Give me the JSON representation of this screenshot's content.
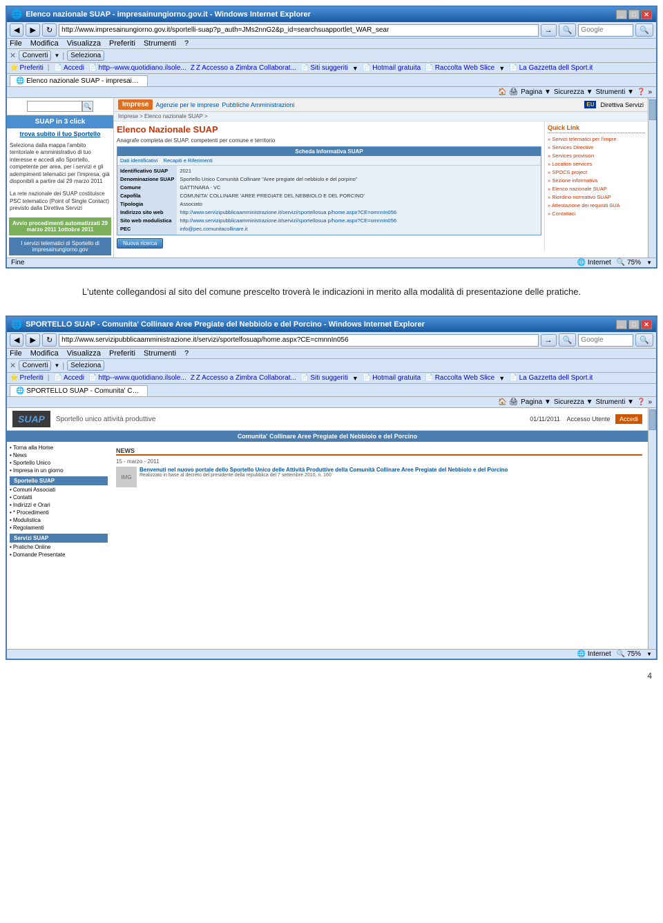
{
  "browser1": {
    "title": "Elenco nazionale SUAP - impresainungiorno.gov.it - Windows Internet Explorer",
    "url": "http://www.impresainungiorno.gov.it/sportelli-suap?p_auth=JMs2nnG2&p_id=searchsuapportlet_WAR_sear",
    "menu": {
      "file": "File",
      "modifica": "Modifica",
      "visualizza": "Visualizza",
      "preferiti": "Preferiti",
      "strumenti": "Strumenti",
      "help": "?"
    },
    "toolbar": {
      "converti": "Converti",
      "seleziona": "Seleziona"
    },
    "bookmarks": {
      "preferiti": "Preferiti",
      "accedi": "Accedi",
      "quotidiano": "http--www.quotidiano.ilsole...",
      "zimbra": "Z Accesso a Zimbra Collaborat...",
      "siti_suggeriti": "Siti suggeriti",
      "hotmail": "Hotmail gratuita",
      "raccolta": "Raccolta Web Slice",
      "gazzetta": "La Gazzetta dell Sport.it"
    },
    "tab": "Elenco nazionale SUAP - impresainungiorno.gov.it",
    "status": {
      "left": "Fine",
      "internet": "Internet",
      "zoom": "75%"
    },
    "page": {
      "search_placeholder": "",
      "left_panel": {
        "title": "SUAP in 3 click",
        "subtitle": "trova subito il tuo Sportello",
        "text1": "Seleziona dalla mappa l'ambito territoriale e amministrativo di tuo interesse e accedi allo Sportello, competente per area, per i servizi e gli adempimenti telematici per l'impresa, già disponibili a partire dal 29 marzo 2011",
        "text2": "La rete nazionale dei SUAP costituisce PSC telematico (Point of Single Contact) previsto dalla Direttiva Servizi",
        "green_box": "Avvio procedimenti automatizzati 29 marzo 2011 1ottobre 2011",
        "blue_box": "I servizi telematici di Sportello di impresainungiorno.gov"
      },
      "top_nav": {
        "imprese": "Imprese",
        "agenzie": "Agenzie per le imprese",
        "pa": "Pubbliche Amministrazioni",
        "eu": "EU",
        "direttiva": "Direttiva Servizi"
      },
      "breadcrumb": "Imprese > Elenco nazionale SUAP >",
      "main_heading": "Elenco Nazionale SUAP",
      "main_desc": "Anagrafe completa dei SUAP, competenti per comune e territorio",
      "info_card": {
        "title": "Scheda Informativa SUAP",
        "fields": {
          "id": "Identificativo SUAP",
          "denominazione": "Denominazione SUAP",
          "comune": "Comune",
          "capofila": "Capofila",
          "tipologia": "Tipologia",
          "indirizzo": "Indirizzo sito web",
          "sito_web": "Sito web modulistica",
          "pec": "PEC"
        },
        "values": {
          "id": "2021",
          "denominazione": "Sportello Unico Comunità Collinare \"Aree pregiate del nebbiolo e del porpino\"",
          "comune": "GATTINARA - VC",
          "capofila": "COMUNITA' COLLINARE 'AREE PREGIATE DEL NEBBIOLO E DEL PORCINO'",
          "tipologia": "Associato",
          "indirizzo": "http://www.servizipubblicaamministrazione.it/servizi/sportellosua p/home.aspx?CE=omnnIn056",
          "sito_web": "http://www.servizipubblicaamministrazione.it/servizi/sportellosua p/home.aspx?CE=omnnIn056",
          "pec": "info@pec.comunitacollinare.it"
        }
      },
      "btn_nova_ricerca": "Nuova ricerca",
      "dati_label": "Dati identificativi",
      "recapiti_label": "Recapiti e Riferimenti",
      "quick_link": {
        "title": "Quick Link",
        "items": [
          "Servizi telematici per l'impre",
          "Services Directive",
          "Services provision",
          "Location services",
          "SPOCS project",
          "Sezione informativa",
          "Elenco nazionale SUAP",
          "Riordino normativo SUAP",
          "Attestazione dei requisiti SUA",
          "Contattaci"
        ]
      }
    }
  },
  "between_text": "L'utente collegandosi al sito del comune prescelto troverà le indicazioni in merito alla modalità di presentazione delle pratiche.",
  "browser2": {
    "title": "SPORTELLO SUAP - Comunita' Collinare Aree Pregiate del Nebbiolo e del Porcino - Windows Internet Explorer",
    "url": "http://www.servizipubblicaamministrazione.it/servizi/sportelfosuap/home.aspx?CE=cmnnIn056",
    "menu": {
      "file": "File",
      "modifica": "Modifica",
      "visualizza": "Visualizza",
      "preferiti": "Preferiti",
      "strumenti": "Strumenti",
      "help": "?"
    },
    "toolbar": {
      "converti": "Converti",
      "seleziona": "Seleziona"
    },
    "bookmarks": {
      "preferiti": "Preferiti",
      "accedi": "Accedi",
      "quotidiano": "http--www.quotidiano.ilsole...",
      "zimbra": "Z Accesso a Zimbra Collaborat...",
      "siti_suggeriti": "Siti suggeriti",
      "hotmail": "Hotmail gratuita",
      "raccolta": "Raccolta Web Slice",
      "gazzetta": "La Gazzetta dell Sport.it"
    },
    "tab": "SPORTELLO SUAP - Comunita' Collinare Aree Pregiate ...",
    "status": {
      "left": "",
      "internet": "Internet",
      "zoom": "75%"
    },
    "page": {
      "date": "01/11/2011",
      "accesso": "Accesso Utente",
      "accedi_btn": "Accedi",
      "logo_suap": "SUAP",
      "tagline": "Sportello unico attività produttive",
      "community_title": "Comunita' Collinare Aree Pregiate del Nebbiolo e del Porcino",
      "left_menu": {
        "section1": "",
        "items1": [
          "Torna alla Home",
          "News",
          "Sportello Unico",
          "Impresa in un giorno"
        ],
        "section2": "Sportello SUAP",
        "items2": [
          "Comuni Associati",
          "Contatti",
          "Indirizzi e Orari",
          "Procedimenti",
          "Modulistica",
          "Regolamenti"
        ],
        "section3": "Servizi SUAP",
        "items3": [
          "Pratiche Online",
          "Domande Presentate"
        ]
      },
      "news": {
        "title": "NEWS",
        "date": "15 - marzo - 2011",
        "headline": "Benvenuti nel nuovo portale dello Sportello Unico delle Attività Produttive della Comunità Collinare Aree Pregiate del Nebbiolo e del Porcino",
        "footnote": "Realizzato in base al decreto del presidente della repubblica del 7 settembre 2010, n. 160"
      }
    }
  },
  "page_number": "4"
}
